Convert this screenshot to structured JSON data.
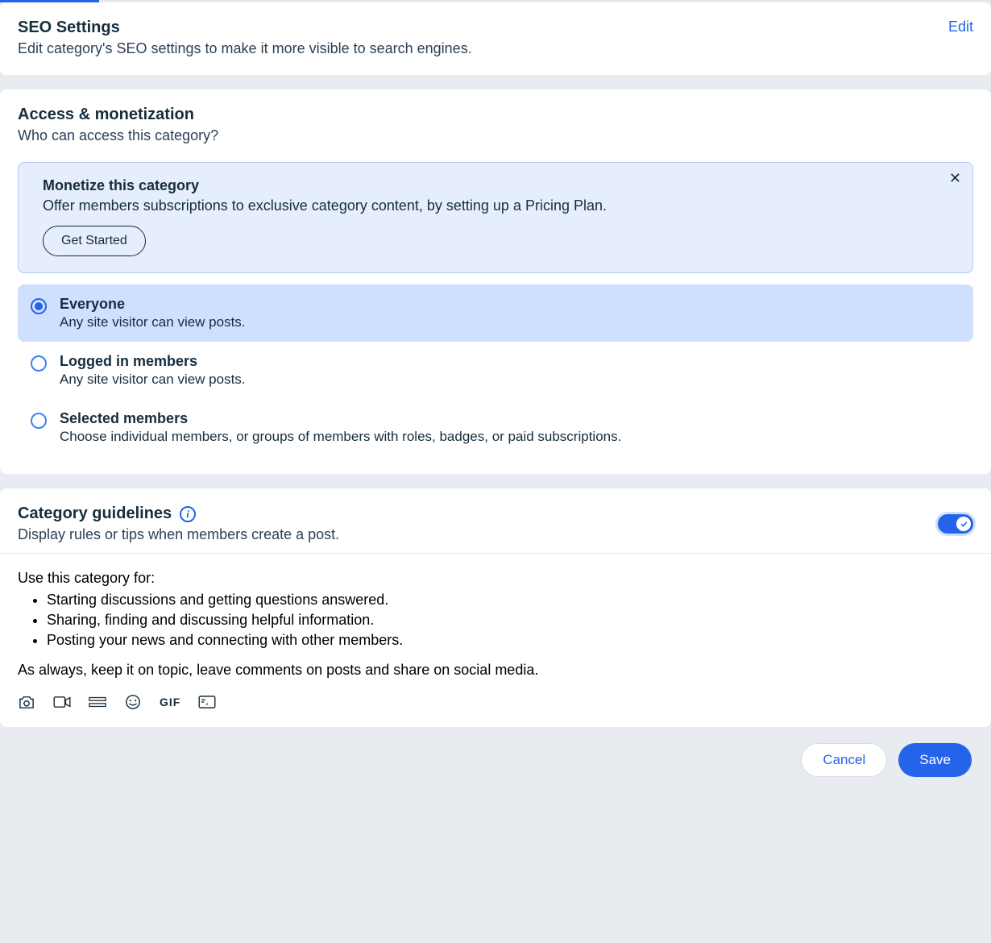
{
  "seo": {
    "title": "SEO Settings",
    "sub": "Edit category's SEO settings to make it more visible to search engines.",
    "edit": "Edit"
  },
  "access": {
    "title": "Access & monetization",
    "sub": "Who can access this category?",
    "banner": {
      "title": "Monetize this category",
      "desc": "Offer members subscriptions to exclusive category content, by setting up a Pricing Plan.",
      "cta": "Get Started"
    },
    "options": [
      {
        "title": "Everyone",
        "desc": "Any site visitor can view posts.",
        "selected": true
      },
      {
        "title": "Logged in members",
        "desc": "Any site visitor can view posts.",
        "selected": false
      },
      {
        "title": "Selected members",
        "desc": "Choose individual members, or groups of members with roles, badges, or paid subscriptions.",
        "selected": false
      }
    ]
  },
  "guidelines": {
    "title": "Category guidelines",
    "sub": "Display rules or tips when members create a post.",
    "toggle_on": true,
    "intro": "Use this category for:",
    "items": [
      "Starting discussions and getting questions answered.",
      "Sharing, finding and discussing helpful information.",
      "Posting your news and connecting with other members."
    ],
    "outro": "As always, keep it on topic, leave comments on posts and share on social media.",
    "toolbar": {
      "gif": "GIF"
    }
  },
  "footer": {
    "cancel": "Cancel",
    "save": "Save"
  }
}
